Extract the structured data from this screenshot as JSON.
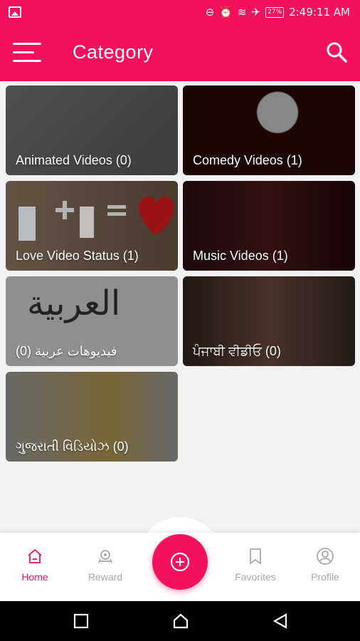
{
  "status_bar": {
    "time": "2:49:11 AM",
    "battery": "27%",
    "icons": [
      "image-icon",
      "dnd-icon",
      "alarm-icon",
      "wifi-icon",
      "airplane-icon",
      "battery-icon"
    ]
  },
  "app_bar": {
    "title": "Category",
    "menu_icon": "hamburger-menu-icon",
    "search_icon": "search-icon"
  },
  "categories": [
    {
      "label": "Animated Videos (0)",
      "color": "#6e6e6e"
    },
    {
      "label": "Comedy Videos (1)",
      "color": "#3a0a0a"
    },
    {
      "label": "Love Video Status (1)",
      "color": "#6e5a44"
    },
    {
      "label": "Music Videos (1)",
      "color": "#2a0f12"
    },
    {
      "label": "(0) فيديوهات عربية",
      "overlay_text": "العربية",
      "color": "#8f8f8f"
    },
    {
      "label": "ਪੰਜਾਬੀ ਵੀਡੀਓ (0)",
      "color": "#3b2a26"
    },
    {
      "label": "ગુજરાતી વિડિયોઝ (0)",
      "color": "#8a8a8a"
    }
  ],
  "bottom_nav": {
    "items": [
      {
        "label": "Home",
        "icon": "home-icon",
        "active": true
      },
      {
        "label": "Reward",
        "icon": "reward-icon",
        "active": false
      },
      {
        "label": "Favorites",
        "icon": "bookmark-icon",
        "active": false
      },
      {
        "label": "Profile",
        "icon": "profile-icon",
        "active": false
      }
    ],
    "fab_icon": "add-circle-icon"
  },
  "colors": {
    "primary": "#f2115a",
    "inactive": "#a8a8a8",
    "background": "#f2f2f2"
  }
}
